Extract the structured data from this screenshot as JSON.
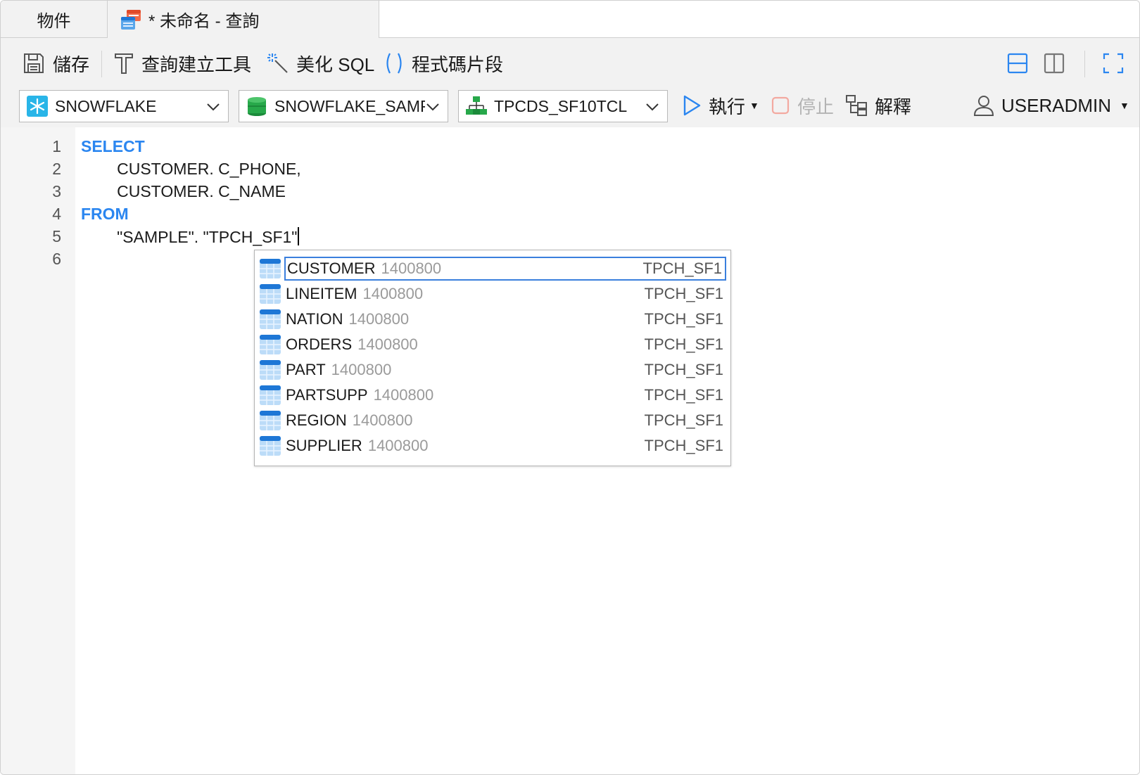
{
  "tabs": {
    "objects_label": "物件",
    "query_label": "* 未命名 - 查詢"
  },
  "toolbar": {
    "save_label": "儲存",
    "query_builder_label": "查詢建立工具",
    "beautify_label": "美化 SQL",
    "snippets_label": "程式碼片段",
    "connection": "SNOWFLAKE",
    "database": "SNOWFLAKE_SAMPLE_DATA",
    "schema": "TPCDS_SF10TCL",
    "run_label": "執行",
    "stop_label": "停止",
    "explain_label": "解釋",
    "user_label": "USERADMIN"
  },
  "editor": {
    "line_numbers": [
      "1",
      "2",
      "3",
      "4",
      "5",
      "6"
    ],
    "lines": {
      "l1_keyword": "SELECT",
      "l2": "        CUSTOMER. C_PHONE,",
      "l3": "        CUSTOMER. C_NAME",
      "l4_keyword": "FROM",
      "l5": "        \"SAMPLE\". \"TPCH_SF1\""
    }
  },
  "autocomplete": {
    "items": [
      {
        "name": "CUSTOMER",
        "rows": "1400800",
        "schema": "TPCH_SF1",
        "selected": true
      },
      {
        "name": "LINEITEM",
        "rows": "1400800",
        "schema": "TPCH_SF1"
      },
      {
        "name": "NATION",
        "rows": "1400800",
        "schema": "TPCH_SF1"
      },
      {
        "name": "ORDERS",
        "rows": "1400800",
        "schema": "TPCH_SF1"
      },
      {
        "name": "PART",
        "rows": "1400800",
        "schema": "TPCH_SF1"
      },
      {
        "name": "PARTSUPP",
        "rows": "1400800",
        "schema": "TPCH_SF1"
      },
      {
        "name": "REGION",
        "rows": "1400800",
        "schema": "TPCH_SF1"
      },
      {
        "name": "SUPPLIER",
        "rows": "1400800",
        "schema": "TPCH_SF1"
      }
    ]
  },
  "colors": {
    "keyword": "#2b86f0",
    "accent": "#2b86f0",
    "toolbar_bg": "#f2f2f2"
  }
}
